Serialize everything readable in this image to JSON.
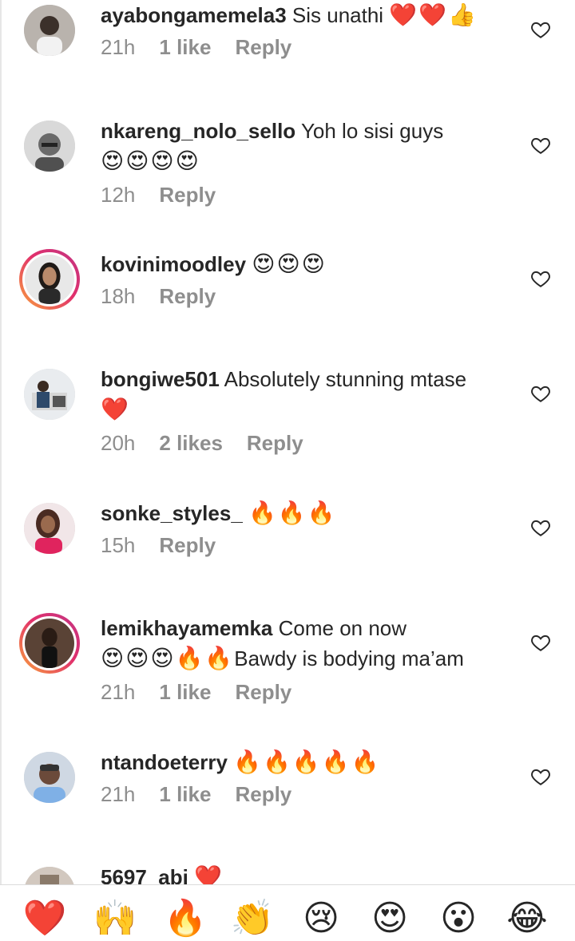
{
  "comments": [
    {
      "user": "ayabongamemela3",
      "text": "Sis unathi",
      "emoji": "❤️❤️👍",
      "time": "21h",
      "likes": "1 like",
      "reply": "Reply"
    },
    {
      "user": "nkareng_nolo_sello",
      "text": "Yoh lo sisi guys",
      "emoji": "😍😍😍😍",
      "time": "12h",
      "likes": "",
      "reply": "Reply"
    },
    {
      "user": "kovinimoodley",
      "text": "",
      "emoji": "😍😍😍",
      "time": "18h",
      "likes": "",
      "reply": "Reply"
    },
    {
      "user": "bongiwe501",
      "text": "Absolutely stunning mtase",
      "emoji": "❤️",
      "time": "20h",
      "likes": "2 likes",
      "reply": "Reply"
    },
    {
      "user": "sonke_styles_",
      "text": "",
      "emoji": "🔥🔥🔥",
      "time": "15h",
      "likes": "",
      "reply": "Reply"
    },
    {
      "user": "lemikhayamemka",
      "text": "Come on now",
      "emoji": "😍😍😍🔥🔥",
      "text2": "Bawdy is bodying ma’am",
      "time": "21h",
      "likes": "1 like",
      "reply": "Reply"
    },
    {
      "user": "ntandoeterry",
      "text": "",
      "emoji": "🔥🔥🔥🔥🔥",
      "time": "21h",
      "likes": "1 like",
      "reply": "Reply"
    },
    {
      "user": "5697_abi",
      "text": "",
      "emoji": "❤️"
    }
  ],
  "quick_reactions": [
    "❤️",
    "🙌",
    "🔥",
    "👏",
    "😢",
    "😍",
    "😮",
    "😂"
  ],
  "colors": {
    "meta": "#8e8e8e",
    "story_ring_start": "#f9a33b",
    "story_ring_end": "#c13584"
  }
}
